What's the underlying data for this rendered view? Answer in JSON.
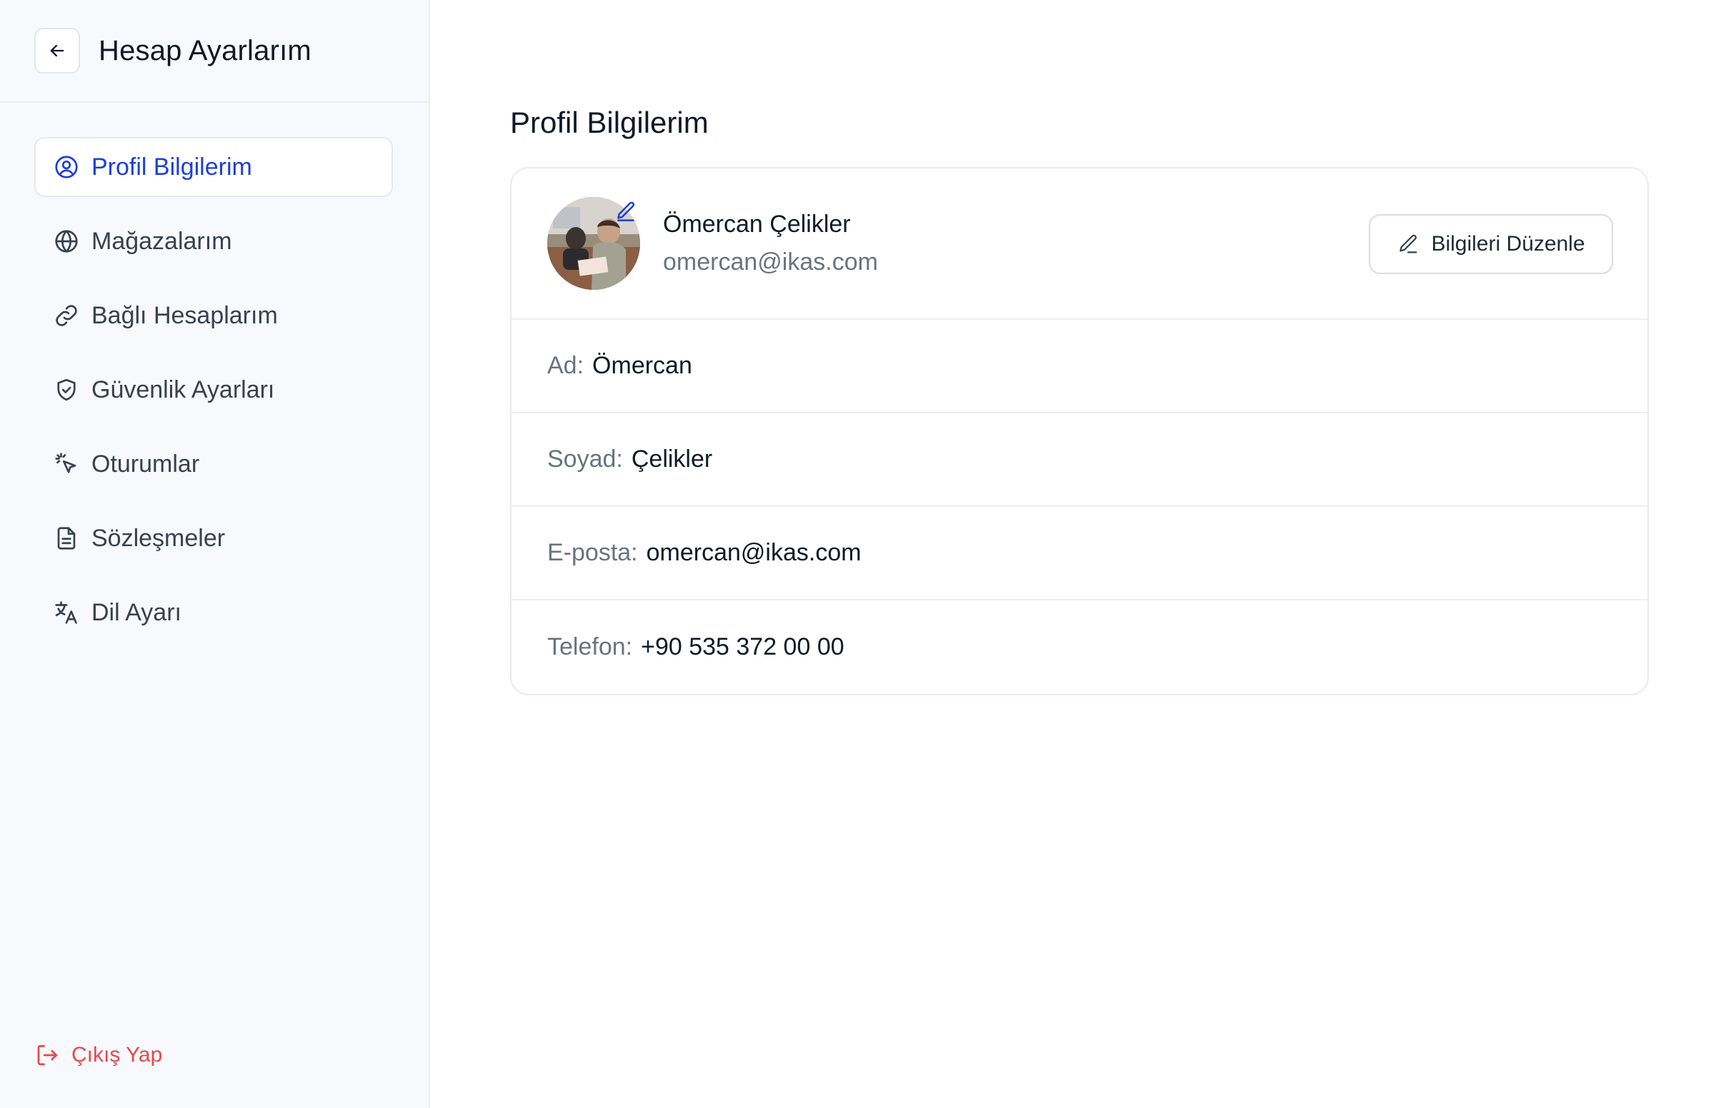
{
  "sidebar": {
    "title": "Hesap Ayarlarım",
    "items": [
      {
        "label": "Profil Bilgilerim",
        "icon": "user-circle-icon",
        "active": true
      },
      {
        "label": "Mağazalarım",
        "icon": "globe-icon",
        "active": false
      },
      {
        "label": "Bağlı Hesaplarım",
        "icon": "link-icon",
        "active": false
      },
      {
        "label": "Güvenlik Ayarları",
        "icon": "shield-check-icon",
        "active": false
      },
      {
        "label": "Oturumlar",
        "icon": "pointer-click-icon",
        "active": false
      },
      {
        "label": "Sözleşmeler",
        "icon": "document-icon",
        "active": false
      },
      {
        "label": "Dil Ayarı",
        "icon": "translate-icon",
        "active": false
      }
    ],
    "logout_label": "Çıkış Yap"
  },
  "main": {
    "section_title": "Profil Bilgilerim",
    "profile": {
      "name": "Ömercan Çelikler",
      "email": "omercan@ikas.com",
      "edit_button_label": "Bilgileri Düzenle"
    },
    "fields": [
      {
        "label": "Ad:",
        "value": "Ömercan"
      },
      {
        "label": "Soyad:",
        "value": "Çelikler"
      },
      {
        "label": "E-posta:",
        "value": "omercan@ikas.com"
      },
      {
        "label": "Telefon:",
        "value": "+90 535 372 00 00"
      }
    ]
  },
  "colors": {
    "accent": "#1d3fd8",
    "danger": "#e5484d",
    "sidebar_bg": "#f8f9fc",
    "muted_text": "#6b7280"
  }
}
